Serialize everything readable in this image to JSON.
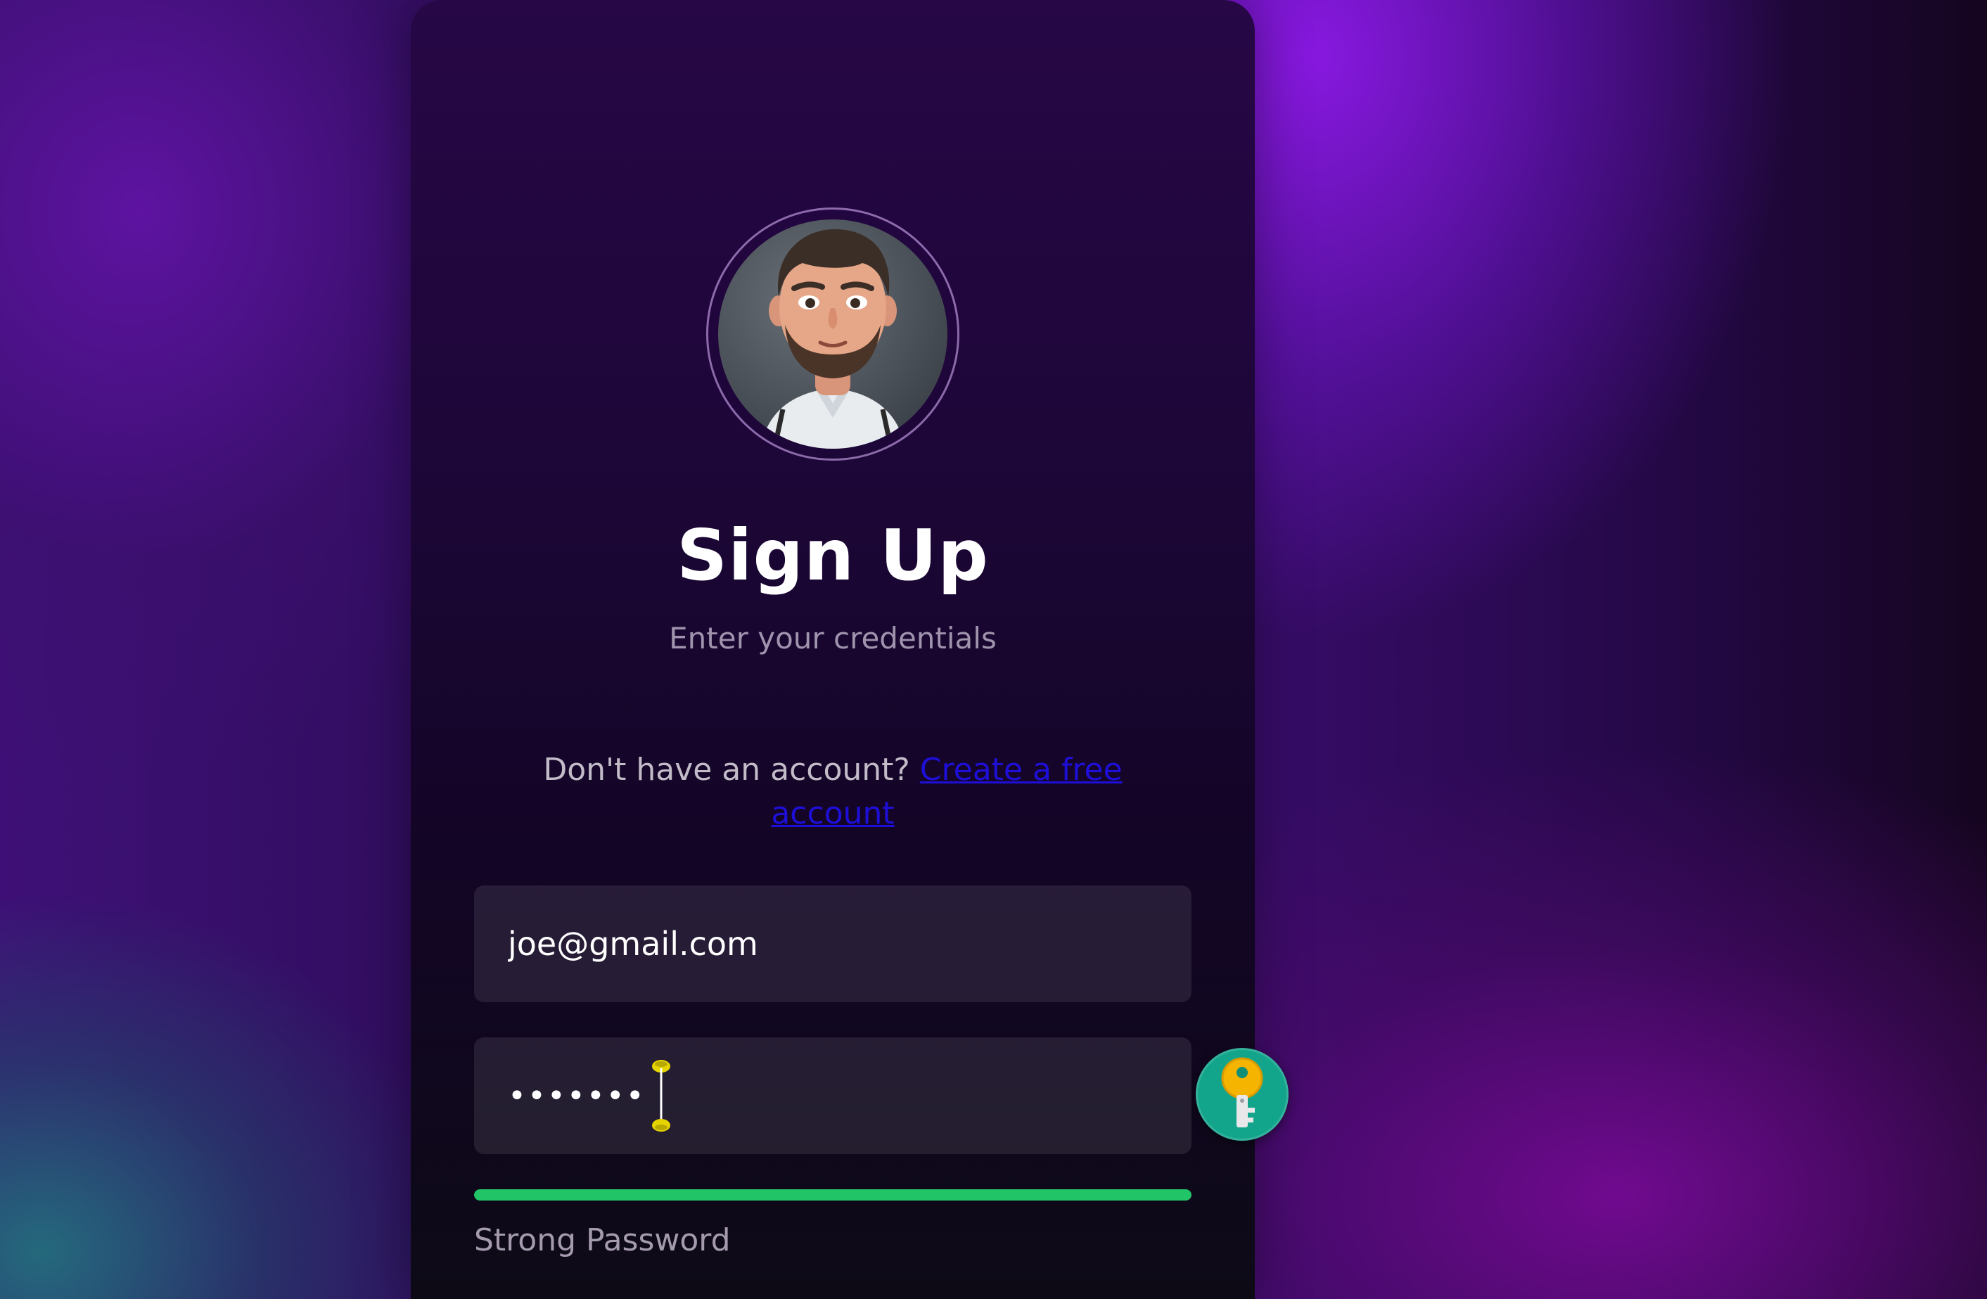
{
  "signup": {
    "title": "Sign Up",
    "subtitle": "Enter your credentials",
    "account_prompt": "Don't have an account?",
    "create_link": "Create a free account"
  },
  "form": {
    "email_value": "joe@gmail.com",
    "password_value": "••••••••••",
    "strength_label": "Strong Password",
    "strength_level": 1.0
  },
  "colors": {
    "strength": "#21c466",
    "link": "#1e0fd8",
    "key_button": "#12a58b"
  },
  "icons": {
    "avatar": "cartoon-man-avatar",
    "password_manager": "key-icon",
    "text_cursor": "text-selection-caret"
  }
}
